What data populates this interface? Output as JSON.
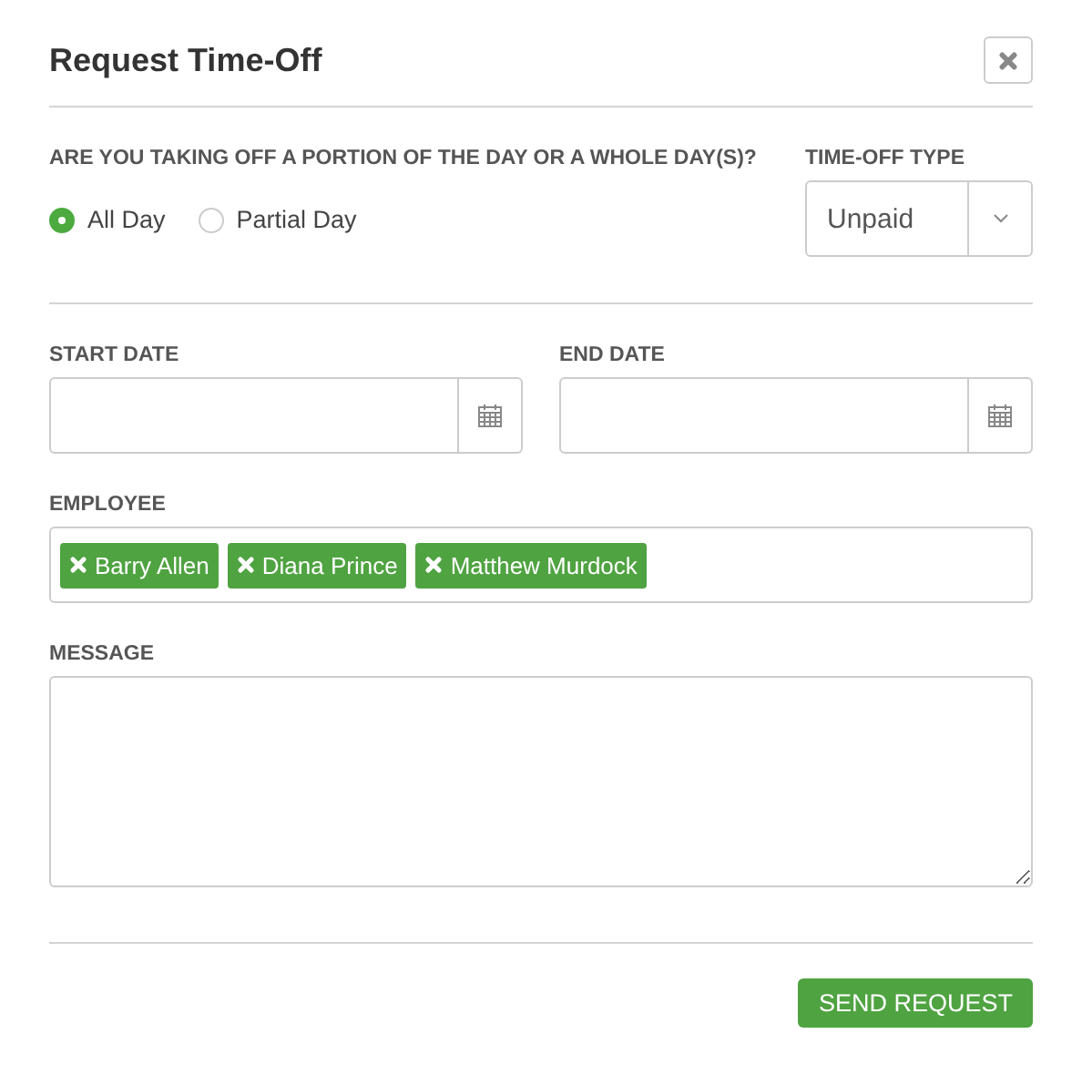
{
  "dialog": {
    "title": "Request Time-Off"
  },
  "duration": {
    "label": "ARE YOU TAKING OFF A PORTION OF THE DAY OR A WHOLE DAY(S)?",
    "options": [
      {
        "label": "All Day",
        "selected": true
      },
      {
        "label": "Partial Day",
        "selected": false
      }
    ]
  },
  "time_off_type": {
    "label": "TIME-OFF TYPE",
    "value": "Unpaid"
  },
  "start_date": {
    "label": "START DATE"
  },
  "end_date": {
    "label": "END DATE"
  },
  "employee": {
    "label": "EMPLOYEE",
    "tags": [
      {
        "name": "Barry Allen"
      },
      {
        "name": "Diana Prince"
      },
      {
        "name": "Matthew Murdock"
      }
    ]
  },
  "message": {
    "label": "MESSAGE"
  },
  "submit": {
    "label": "SEND REQUEST"
  }
}
